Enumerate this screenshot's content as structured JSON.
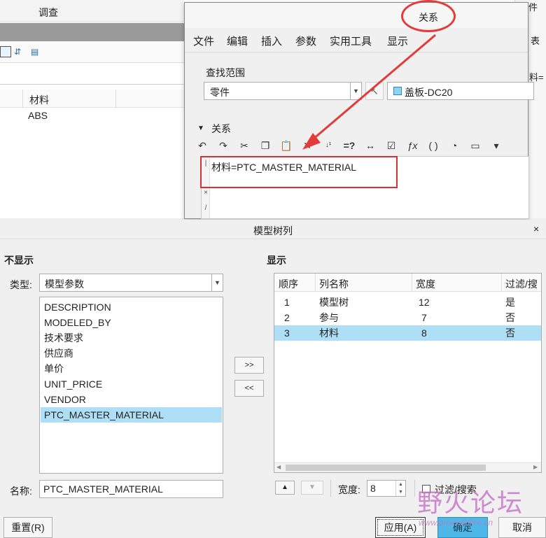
{
  "background_app": {
    "tab_survey": "调查",
    "column_header": "材料",
    "cell_value": "ABS",
    "right_label_part": "零件",
    "right_label_s": "表",
    "right_label_m": "料="
  },
  "relations_window": {
    "title": "关系",
    "menu": [
      "文件",
      "编辑",
      "插入",
      "参数",
      "实用工具",
      "显示"
    ],
    "scope_label": "查找范围",
    "scope_value": "零件",
    "part_name": "盖板-DC20",
    "section_label": "关系",
    "editor_text": "材料=PTC_MASTER_MATERIAL",
    "toolbar_icons": [
      "undo-icon",
      "redo-icon",
      "cut-icon",
      "copy-icon",
      "paste-icon",
      "delete-icon",
      "sort-icon",
      "evaluate-icon",
      "measure-icon",
      "verify-icon",
      "function-icon",
      "bracket-icon",
      "param-icon",
      "display-icon",
      "more-icon"
    ]
  },
  "model_tree_dialog": {
    "title": "模型树列",
    "hidden_label": "不显示",
    "shown_label": "显示",
    "type_label": "类型:",
    "type_value": "模型参数",
    "hidden_items": [
      "DESCRIPTION",
      "MODELED_BY",
      "技术要求",
      "供应商",
      "单价",
      "UNIT_PRICE",
      "VENDOR",
      "PTC_MASTER_MATERIAL"
    ],
    "selected_hidden_index": 7,
    "add_label": ">>",
    "remove_label": "<<",
    "table": {
      "headers": [
        "顺序",
        "列名称",
        "宽度",
        "过滤/搜"
      ],
      "rows": [
        {
          "order": "1",
          "name": "模型树",
          "width": "12",
          "filter": "是"
        },
        {
          "order": "2",
          "name": "参与",
          "width": "7",
          "filter": "否"
        },
        {
          "order": "3",
          "name": "材料",
          "width": "8",
          "filter": "否"
        }
      ],
      "selected_row_index": 2
    },
    "width_label": "宽度:",
    "width_value": "8",
    "filter_label": "过滤/搜索",
    "name_label": "名称:",
    "name_value": "PTC_MASTER_MATERIAL",
    "reset_label": "重置(R)",
    "apply_label": "应用(A)",
    "ok_label": "确定",
    "cancel_label": "取消"
  },
  "watermark": {
    "text": "野火论坛",
    "url": "www.proewildfire.cn"
  },
  "colors": {
    "selection": "#aedff7",
    "annotation_red": "#e33a3a",
    "ok_button": "#4db7e8"
  }
}
